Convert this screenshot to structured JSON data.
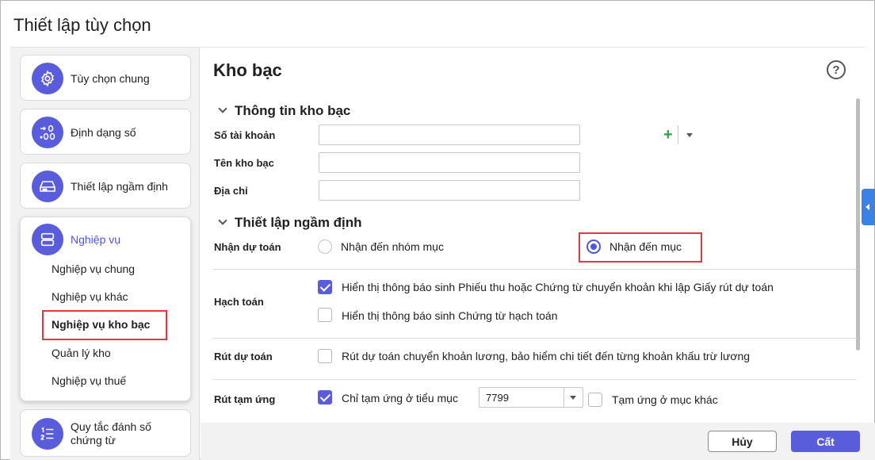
{
  "window": {
    "title": "Thiết lập tùy chọn"
  },
  "sidebar": {
    "cards": [
      {
        "label": "Tùy chọn chung",
        "icon": "gear-icon"
      },
      {
        "label": "Định dạng số",
        "icon": "number-format-icon"
      },
      {
        "label": "Thiết lập ngầm định",
        "icon": "storage-drive-icon"
      },
      {
        "label": "Nghiệp vụ",
        "icon": "server-stack-icon"
      },
      {
        "label_line1": "Quy tắc đánh số",
        "label_line2": "chứng từ",
        "icon": "numbered-list-icon"
      }
    ],
    "sub_items": [
      "Nghiệp vụ chung",
      "Nghiệp vụ khác",
      "Nghiệp vụ kho bạc",
      "Quản lý kho",
      "Nghiệp vụ thuế"
    ]
  },
  "main": {
    "heading": "Kho bạc",
    "help": "?",
    "section_info": {
      "title": "Thông tin kho bạc",
      "fields": [
        {
          "label": "Số tài khoản",
          "value": ""
        },
        {
          "label": "Tên kho bạc",
          "value": ""
        },
        {
          "label": "Địa chỉ",
          "value": ""
        }
      ]
    },
    "section_default": {
      "title": "Thiết lập ngầm định",
      "receive_estimate": {
        "label": "Nhận dự toán",
        "options": [
          "Nhận đến nhóm mục",
          "Nhận đến mục"
        ],
        "selected": "Nhận đến mục"
      },
      "accounting": {
        "label": "Hạch toán",
        "options": [
          {
            "text": "Hiển thị thông báo sinh Phiếu thu hoặc Chứng từ chuyển khoản khi lập Giấy rút dự toán",
            "checked": true
          },
          {
            "text": "Hiển thị thông báo sinh Chứng từ hạch toán",
            "checked": false
          }
        ]
      },
      "withdraw_estimate": {
        "label": "Rút dự toán",
        "option": {
          "text": "Rút dự toán chuyển khoản lương, bảo hiểm chi tiết đến từng khoản khấu trừ lương",
          "checked": false
        }
      },
      "withdraw_advance": {
        "label": "Rút tạm ứng",
        "option1": {
          "text": "Chỉ tạm ứng ở tiểu mục",
          "checked": true
        },
        "combo_value": "7799",
        "option2": {
          "text": "Tạm ứng ở mục khác",
          "checked": false
        }
      }
    }
  },
  "footer": {
    "cancel_label": "Hủy",
    "save_label": "Cất"
  },
  "colors": {
    "accent": "#5a5ddb",
    "highlight_border": "#e5363b",
    "add_icon": "#2aa63a",
    "side_tab": "#3b82e6"
  }
}
